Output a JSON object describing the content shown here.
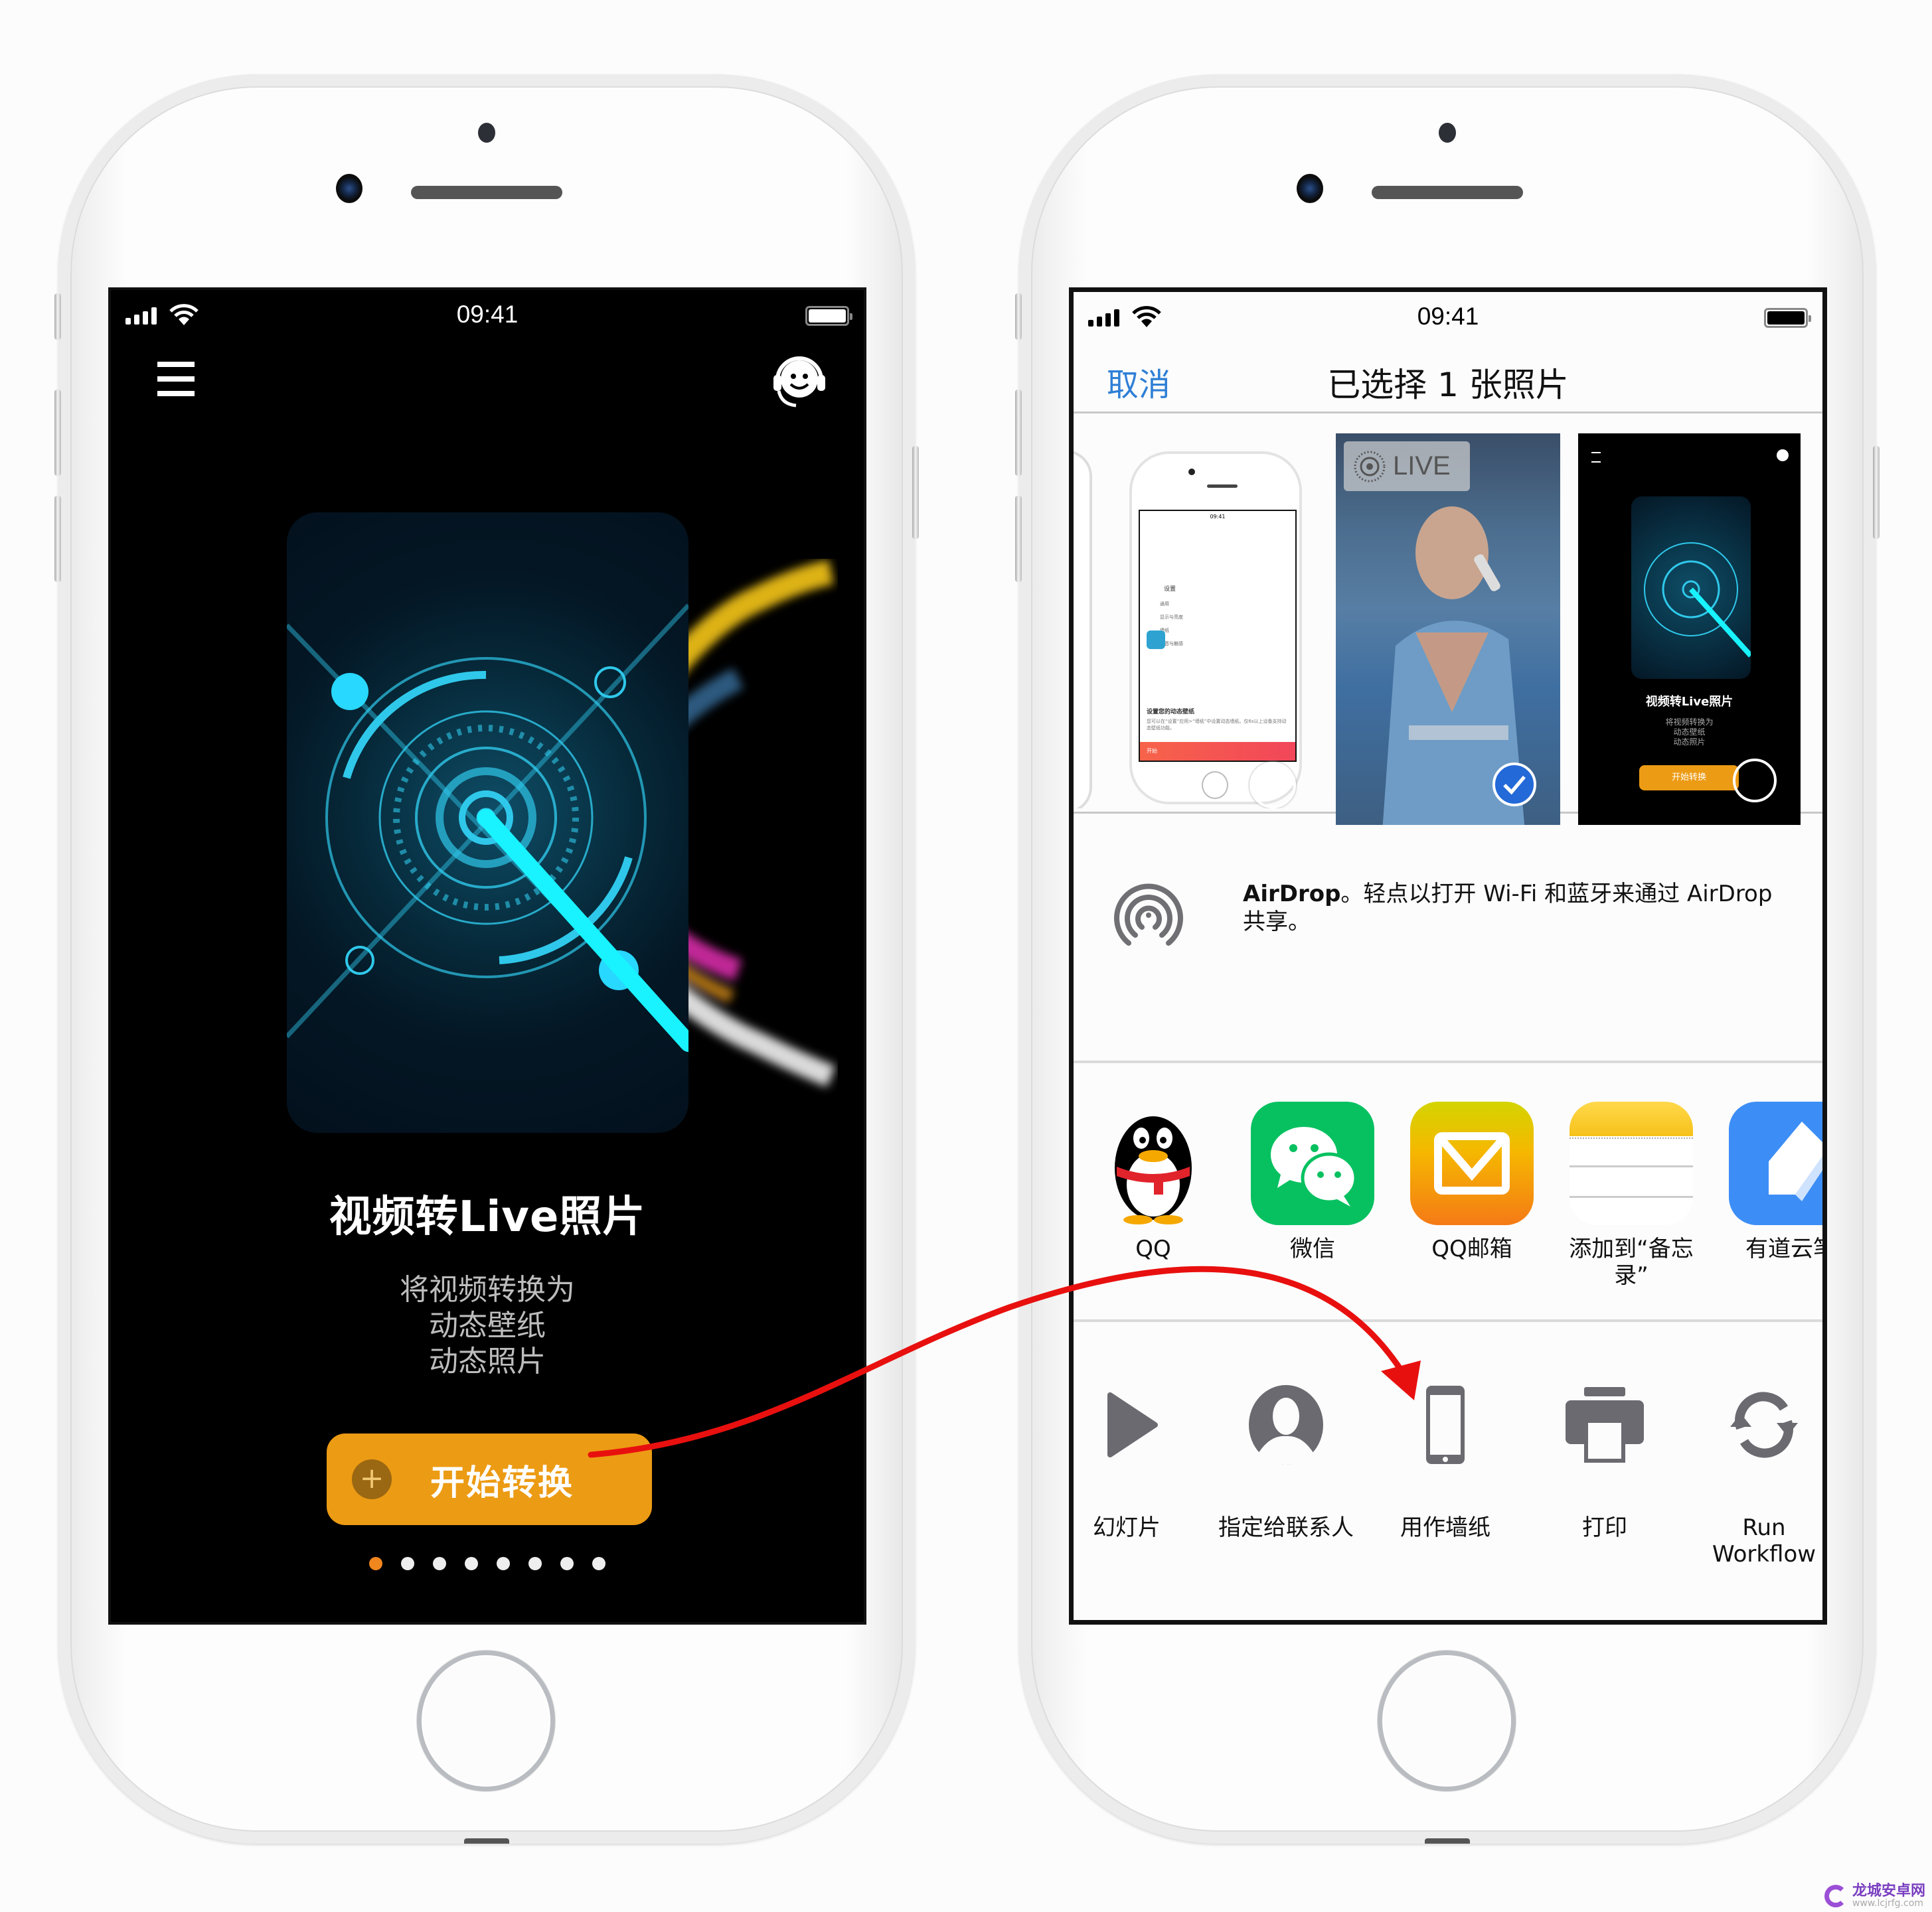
{
  "left_screen": {
    "status_bar": {
      "time": "09:41",
      "signal_bars": 4,
      "wifi": true,
      "battery_percent": 100
    },
    "header": {
      "menu_icon": "hamburger-menu-icon",
      "support_icon": "customer-service-headset-icon"
    },
    "hero": {
      "title": "视频转Live照片",
      "subtitle_lines": [
        "将视频转换为",
        "动态壁纸",
        "动态照片"
      ]
    },
    "start_button": {
      "icon": "plus-icon",
      "label": "开始转换"
    },
    "page_indicator": {
      "total": 8,
      "current": 1,
      "active_color": "#f0861e"
    }
  },
  "right_screen": {
    "status_bar": {
      "time": "09:41",
      "signal_bars": 4,
      "wifi": true,
      "battery_percent": 100
    },
    "nav": {
      "cancel_label": "取消",
      "title": "已选择 1 张照片"
    },
    "thumbnails": [
      {
        "kind": "partial-phone-mockup",
        "selected": false
      },
      {
        "kind": "phone-mockup-settings",
        "selected": false,
        "content": {
          "time": "09:41",
          "menu_title": "设置",
          "items": [
            "通用",
            "显示与亮度",
            "墙纸",
            "声音与触感"
          ],
          "heading": "设置您的动态壁纸",
          "body": "您可以在“设置”应用>“墙纸”中设置动态墙纸。仅6s以上设备支持动态壁纸功能。",
          "button": "开始"
        }
      },
      {
        "kind": "live-photo",
        "badge": "LIVE",
        "selected": true
      },
      {
        "kind": "app-screenshot",
        "selected": false,
        "content": {
          "title": "视频转Live照片",
          "subtitle_lines": [
            "将视频转换为",
            "动态壁纸",
            "动态照片"
          ],
          "button": "开始转换"
        }
      }
    ],
    "airdrop": {
      "icon": "airdrop-icon",
      "bold": "AirDrop",
      "text": "。轻点以打开 Wi-Fi 和蓝牙来通过 AirDrop 共享。"
    },
    "share_apps": [
      {
        "label": "QQ",
        "icon": "qq-penguin-icon",
        "color": "#000000"
      },
      {
        "label": "微信",
        "icon": "wechat-icon",
        "color": "#07c160"
      },
      {
        "label": "QQ邮箱",
        "icon": "qq-mail-icon",
        "color": "#f5a000"
      },
      {
        "label": "添加到“备忘录”",
        "icon": "notes-icon",
        "color": "#ffd43b"
      },
      {
        "label": "有道云笔",
        "icon": "youdao-note-icon",
        "color": "#3c8ef6"
      }
    ],
    "actions": [
      {
        "label": "幻灯片",
        "icon": "play-icon"
      },
      {
        "label": "指定给联系人",
        "icon": "contact-icon"
      },
      {
        "label": "用作墙纸",
        "icon": "phone-wallpaper-icon"
      },
      {
        "label": "打印",
        "icon": "printer-icon"
      },
      {
        "label": "Run Workflow",
        "icon": "run-workflow-icon"
      }
    ]
  },
  "annotation": {
    "type": "curved-arrow",
    "from": "start_button",
    "to": "用作墙纸",
    "color": "#e8100f"
  },
  "watermark": {
    "name": "龙城安卓网",
    "url": "www.lcjrfg.com"
  }
}
